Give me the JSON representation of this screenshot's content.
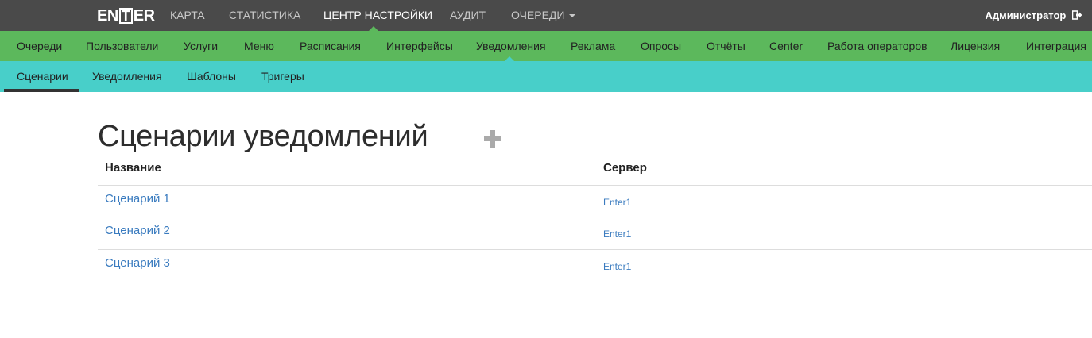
{
  "top": {
    "logo": {
      "part1": "EN",
      "part2": "T",
      "part3": "ER"
    },
    "nav": [
      {
        "label": "КАРТА"
      },
      {
        "label": "СТАТИСТИКА"
      },
      {
        "label": "ЦЕНТР НАСТРОЙКИ"
      },
      {
        "label": "АУДИТ"
      },
      {
        "label": "ОЧЕРЕДИ"
      }
    ],
    "user": "Администратор",
    "colors": {
      "bar": "#4a4a4a",
      "text": "#c8c8c8",
      "active": "#ffffff"
    }
  },
  "green_nav": {
    "items": [
      {
        "label": "Очереди"
      },
      {
        "label": "Пользователи"
      },
      {
        "label": "Услуги"
      },
      {
        "label": "Меню"
      },
      {
        "label": "Расписания"
      },
      {
        "label": "Интерфейсы"
      },
      {
        "label": "Уведомления"
      },
      {
        "label": "Реклама"
      },
      {
        "label": "Опросы"
      },
      {
        "label": "Отчёты"
      },
      {
        "label": "Center"
      },
      {
        "label": "Работа операторов"
      },
      {
        "label": "Лицензия"
      },
      {
        "label": "Интеграция"
      }
    ],
    "active": "Уведомления",
    "color": "#5cb85c"
  },
  "teal_nav": {
    "items": [
      {
        "label": "Сценарии"
      },
      {
        "label": "Уведомления"
      },
      {
        "label": "Шаблоны"
      },
      {
        "label": "Тригеры"
      }
    ],
    "active": "Сценарии",
    "color": "#48cfc9"
  },
  "main": {
    "title": "Сценарии уведомлений",
    "add_icon": "plus-icon",
    "table": {
      "headers": [
        "Название",
        "Сервер"
      ],
      "rows": [
        {
          "name": "Сценарий 1",
          "server": "Enter1"
        },
        {
          "name": "Сценарий 2",
          "server": "Enter1"
        },
        {
          "name": "Сценарий 3",
          "server": "Enter1"
        }
      ]
    },
    "link_color": "#3a7bbf"
  }
}
